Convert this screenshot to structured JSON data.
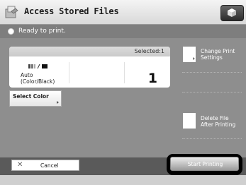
{
  "header": {
    "title": "Access Stored Files",
    "app_icon": "access-files-icon",
    "top_right_icon": "cube-icon"
  },
  "status": {
    "text": "Ready to print."
  },
  "panel": {
    "selected": "Selected:1",
    "color_mode": "Auto\n(Color/Black)",
    "copies": "1"
  },
  "buttons": {
    "select_color": "Select Color",
    "change_print_settings": "Change Print\nSettings",
    "delete_file_after_printing": "Delete File\nAfter Printing",
    "cancel": "Cancel",
    "start_printing": "Start Printing"
  }
}
